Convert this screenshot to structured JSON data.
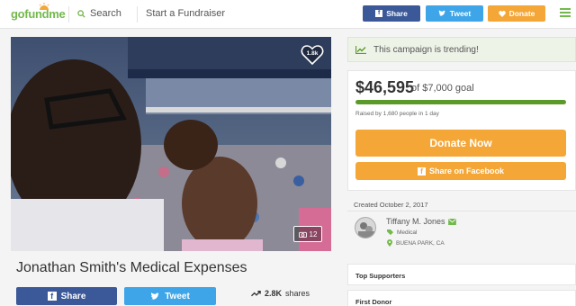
{
  "nav": {
    "logo_left": "go",
    "logo_mid": "fund",
    "logo_right": "me",
    "search_label": "Search",
    "start_label": "Start a Fundraiser",
    "share_label": "Share",
    "tweet_label": "Tweet",
    "donate_label": "Donate",
    "icons": [
      "facebook-icon",
      "twitter-icon",
      "heart-icon",
      "search-icon",
      "menu-icon"
    ]
  },
  "photo": {
    "hearts_count": "1.8k",
    "photo_count": "12"
  },
  "campaign": {
    "title": "Jonathan Smith's Medical Expenses",
    "share_label": "Share",
    "tweet_label": "Tweet",
    "shares_count": "2.8K",
    "shares_suffix": "shares"
  },
  "trending": {
    "text": "This campaign is trending!"
  },
  "funding": {
    "raised": "$46,595",
    "goal_text": "of $7,000 goal",
    "progress_fraction": 1.0,
    "raised_by": "Raised by 1,680 people in 1 day",
    "donate_now_label": "Donate Now",
    "share_facebook_label": "Share on Facebook"
  },
  "organizer": {
    "created": "Created October 2, 2017",
    "name": "Tiffany M. Jones",
    "category": "Medical",
    "location": "BUENA PARK, CA"
  },
  "sections": {
    "top_supporters": "Top Supporters",
    "first_donor": "First Donor"
  },
  "colors": {
    "brand_green": "#73b94c",
    "facebook": "#3b5998",
    "twitter": "#3ea5e8",
    "donate_orange": "#f4a637",
    "progress_green": "#5b9a2a"
  }
}
